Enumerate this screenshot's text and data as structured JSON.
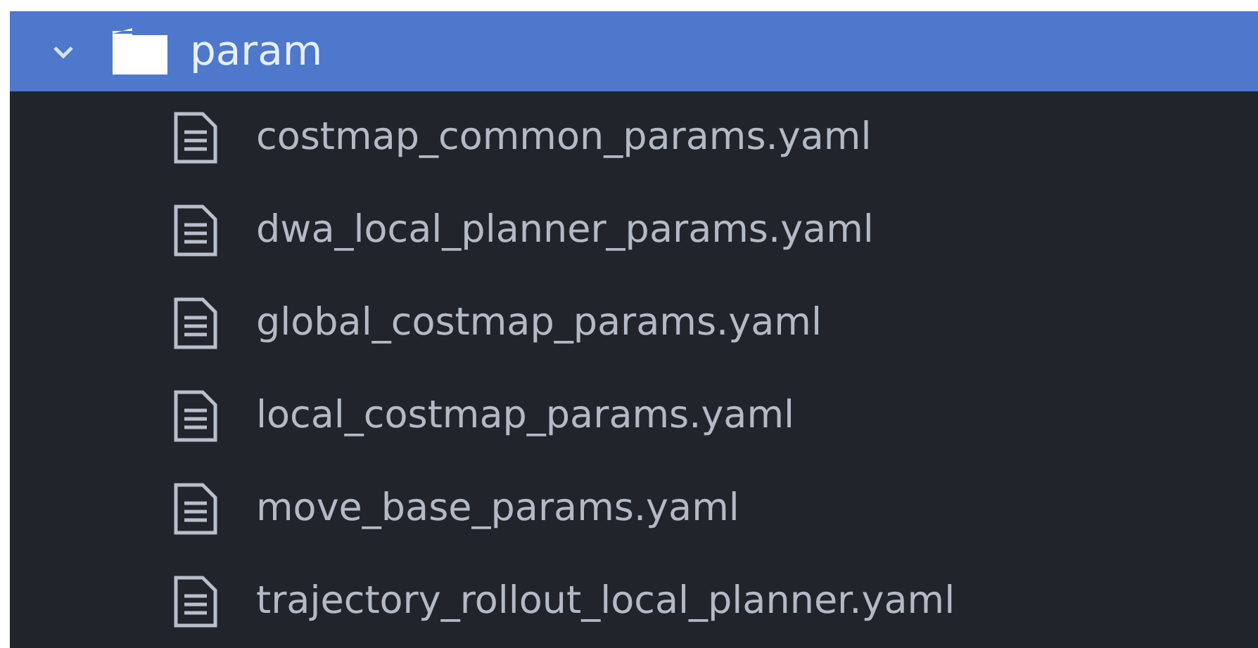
{
  "folder": {
    "name": "param",
    "expanded": true,
    "selected": true,
    "children": [
      {
        "name": "costmap_common_params.yaml"
      },
      {
        "name": "dwa_local_planner_params.yaml"
      },
      {
        "name": "global_costmap_params.yaml"
      },
      {
        "name": "local_costmap_params.yaml"
      },
      {
        "name": "move_base_params.yaml"
      },
      {
        "name": "trajectory_rollout_local_planner.yaml"
      }
    ]
  }
}
